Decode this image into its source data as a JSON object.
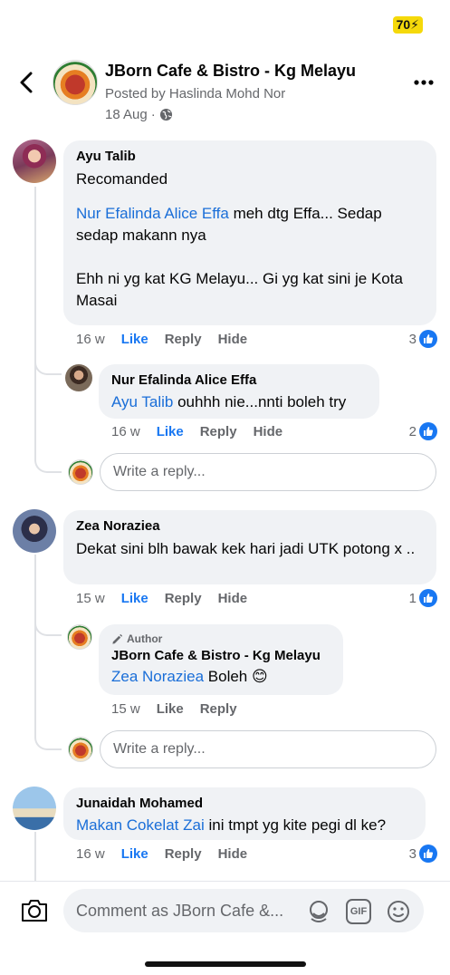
{
  "status": {
    "battery": "70"
  },
  "header": {
    "page_name": "JBorn Cafe & Bistro - Kg Melayu",
    "posted_by": "Posted by Haslinda Mohd Nor",
    "date": "18 Aug",
    "separator": "·"
  },
  "comments": [
    {
      "name": "Ayu Talib",
      "line1": "Recomanded",
      "mention": "Nur Efalinda Alice Effa",
      "line2": " meh dtg Effa... Sedap sedap makann nya",
      "line3": "Ehh ni yg kat KG Melayu... Gi yg kat sini je Kota Masai",
      "time": "16 w",
      "like": "Like",
      "reply": "Reply",
      "hide": "Hide",
      "reactions": "3"
    },
    {
      "name": "Zea Noraziea",
      "text": "Dekat sini blh  bawak kek hari jadi  UTK potong x ..",
      "time": "15 w",
      "like": "Like",
      "reply": "Reply",
      "hide": "Hide",
      "reactions": "1"
    },
    {
      "name": "Junaidah Mohamed",
      "mention": "Makan Cokelat Zai",
      "text": " ini tmpt yg kite pegi dl ke?",
      "time": "16 w",
      "like": "Like",
      "reply": "Reply",
      "hide": "Hide",
      "reactions": "3"
    }
  ],
  "replies": [
    {
      "name": "Nur Efalinda Alice Effa",
      "mention": "Ayu Talib",
      "text": " ouhhh nie...nnti boleh try",
      "time": "16 w",
      "like": "Like",
      "reply": "Reply",
      "hide": "Hide",
      "reactions": "2"
    },
    {
      "author_label": "Author",
      "name": "JBorn Cafe & Bistro - Kg Melayu",
      "mention": "Zea Noraziea",
      "text": " Boleh ",
      "emoji": "😊",
      "time": "15 w",
      "like": "Like",
      "reply": "Reply"
    }
  ],
  "reply_placeholder": "Write a reply...",
  "comment_placeholder": "Comment as JBorn Cafe &...",
  "gif_label": "GIF",
  "colors": {
    "accent": "#1877f2",
    "mention": "#1a6ed8",
    "bubble": "#f0f2f5",
    "muted": "#65676b"
  }
}
